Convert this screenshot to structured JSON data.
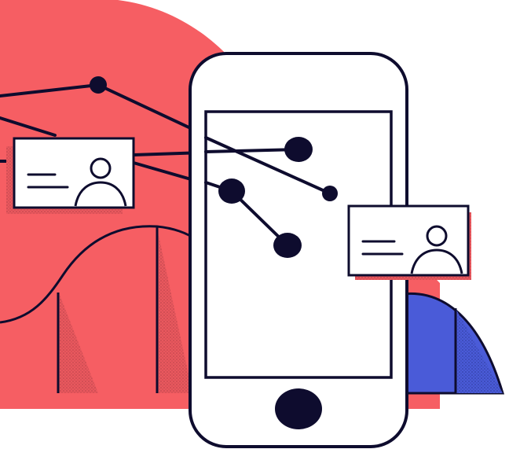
{
  "scene": {
    "description_name": "phone-network-illustration",
    "colors": {
      "background": "#ffffff",
      "coral": "#F65E63",
      "coral_dark": "#C94A52",
      "blue": "#4A5BD8",
      "navy": "#0E0C2E",
      "card_fill": "#ffffff",
      "phone_fill": "#ffffff"
    },
    "icons": {
      "phone": "smartphone-icon",
      "card_left": "profile-card-icon",
      "card_right": "profile-card-icon",
      "avatar": "user-avatar-icon",
      "nodes": "network-node-icon"
    }
  }
}
